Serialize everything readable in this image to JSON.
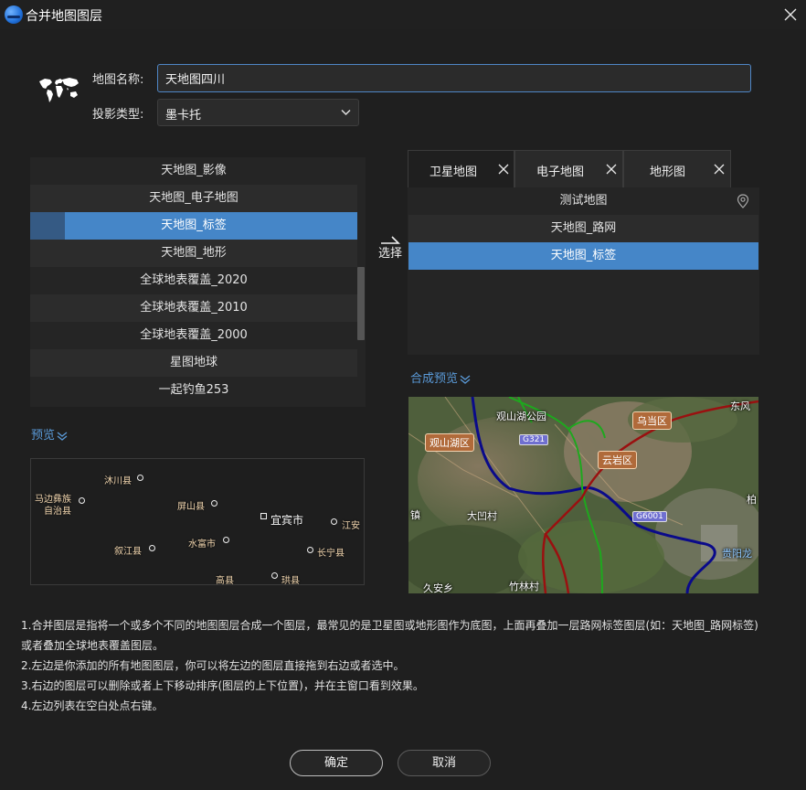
{
  "window": {
    "title": "合并地图图层"
  },
  "form": {
    "name_label": "地图名称:",
    "name_value": "天地图四川",
    "projection_label": "投影类型:",
    "projection_value": "墨卡托"
  },
  "left_list": {
    "items": [
      "天地图_影像",
      "天地图_电子地图",
      "天地图_标签",
      "天地图_地形",
      "全球地表覆盖_2020",
      "全球地表覆盖_2010",
      "全球地表覆盖_2000",
      "星图地球",
      "一起钓鱼253"
    ],
    "selected_index": 2
  },
  "select_label": "选择",
  "tabs": [
    {
      "label": "卫星地图",
      "active": true
    },
    {
      "label": "电子地图",
      "active": false
    },
    {
      "label": "地形图",
      "active": false
    }
  ],
  "right_list": {
    "items": [
      "测试地图",
      "天地图_路网",
      "天地图_标签"
    ],
    "selected_index": 2
  },
  "left_preview_label": "预览",
  "right_preview_label": "合成预览",
  "vector_map": {
    "places": [
      "沐川县",
      "马边彝族",
      "自治县",
      "屏山县",
      "宜宾市",
      "江安",
      "叙江县",
      "水富市",
      "长宁县",
      "高县",
      "珙县"
    ]
  },
  "satellite_map": {
    "labels": [
      "观山湖公园",
      "乌当区",
      "东风",
      "观山湖区",
      "G321",
      "云岩区",
      "镇",
      "大凹村",
      "G6001",
      "柏",
      "贵阳龙",
      "久安乡",
      "竹林村"
    ]
  },
  "notes": [
    "1.合并图层是指将一个或多个不同的地图图层合成一个图层，最常见的是卫星图或地形图作为底图，上面再叠加一层路网标签图层(如：天地图_路网标签)",
    "或者叠加全球地表覆盖图层。",
    "2.左边是你添加的所有地图图层，你可以将左边的图层直接拖到右边或者选中。",
    "3.右边的图层可以删除或者上下移动排序(图层的上下位置)，并在主窗口看到效果。",
    "4.左边列表在空白处点右键。"
  ],
  "buttons": {
    "ok": "确定",
    "cancel": "取消"
  }
}
